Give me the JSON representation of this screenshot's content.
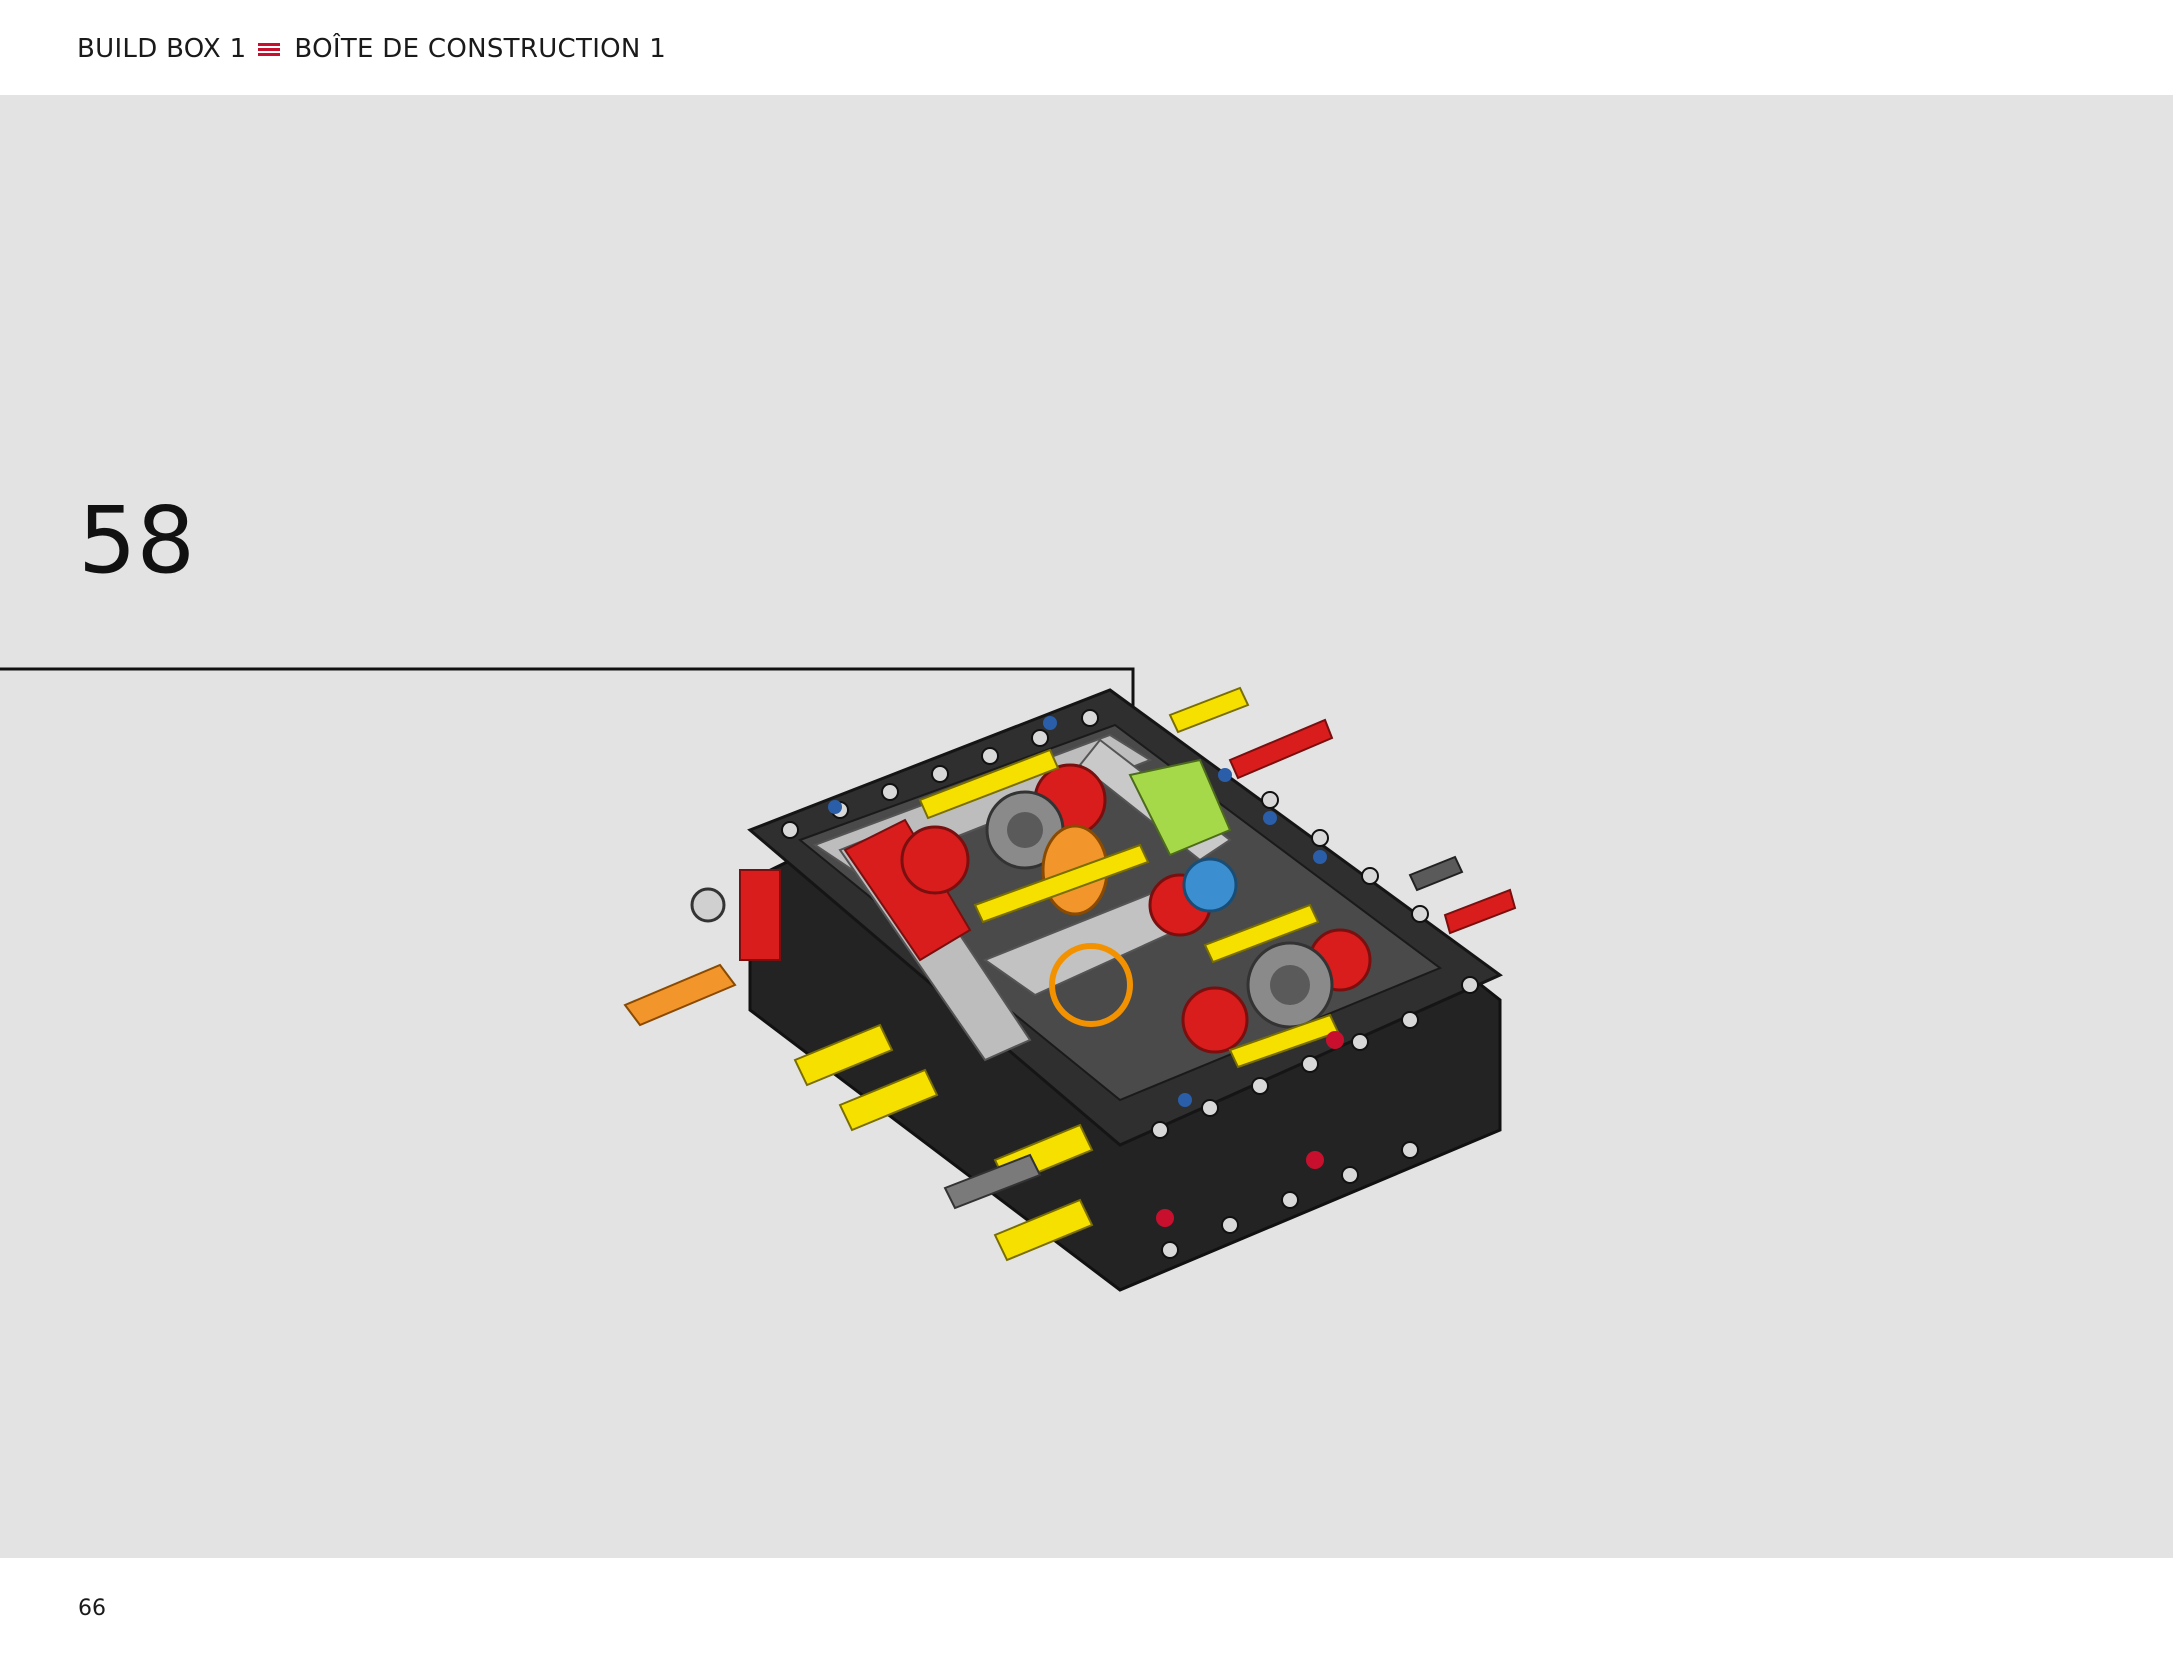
{
  "header": {
    "left_label": "BUILD BOX 1",
    "right_label": "BOÎTE DE CONSTRUCTION 1",
    "accent_color": "#c8102e"
  },
  "step": {
    "number": "58"
  },
  "footer": {
    "page_number": "66"
  },
  "colors": {
    "background": "#e3e3e3",
    "frame": "#2b2b2b",
    "highlight_circle": "#f39200"
  },
  "icons": [
    "menu-icon",
    "down-arrow-icon"
  ]
}
